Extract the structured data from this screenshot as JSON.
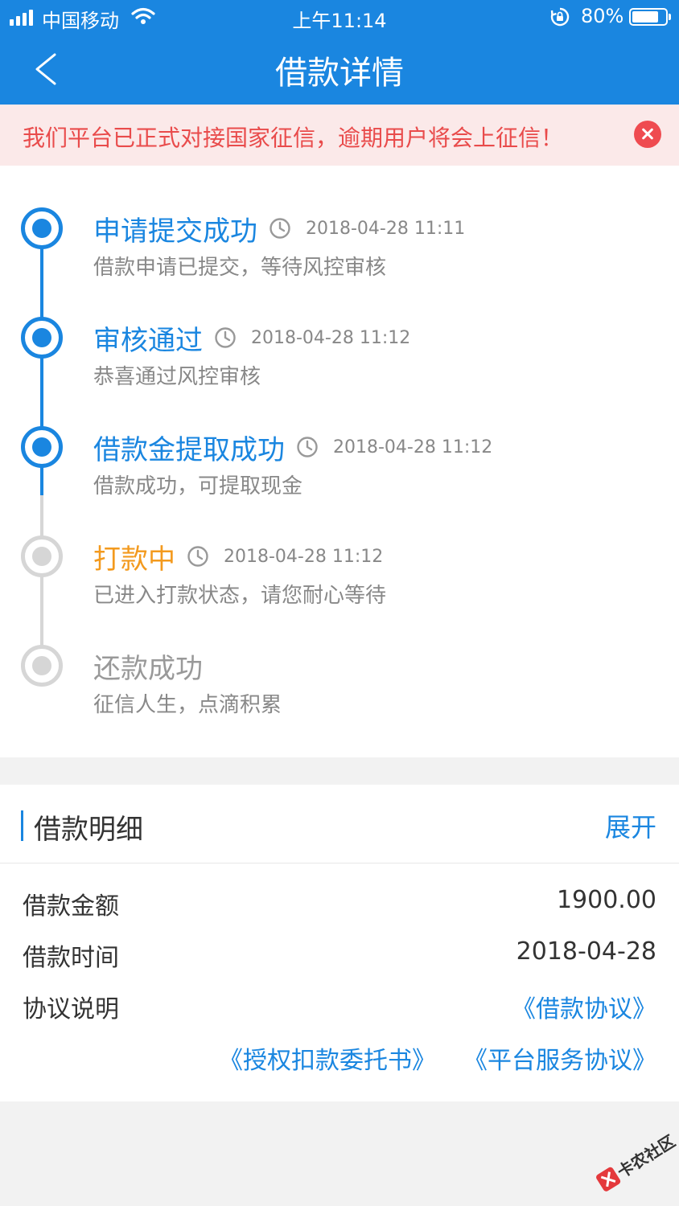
{
  "status_bar": {
    "carrier": "中国移动",
    "time": "上午11:14",
    "battery": "80%",
    "battery_level": 0.8
  },
  "nav": {
    "title": "借款详情"
  },
  "notice": {
    "text": "我们平台已正式对接国家征信，逾期用户将会上征信！"
  },
  "timeline": [
    {
      "title": "申请提交成功",
      "time": "2018-04-28 11:11",
      "desc": "借款申请已提交，等待风控审核",
      "state": "done"
    },
    {
      "title": "审核通过",
      "time": "2018-04-28 11:12",
      "desc": "恭喜通过风控审核",
      "state": "done"
    },
    {
      "title": "借款金提取成功",
      "time": "2018-04-28 11:12",
      "desc": "借款成功，可提取现金",
      "state": "done"
    },
    {
      "title": "打款中",
      "time": "2018-04-28 11:12",
      "desc": "已进入打款状态，请您耐心等待",
      "state": "current"
    },
    {
      "title": "还款成功",
      "time": "",
      "desc": "征信人生，点滴积累",
      "state": "pending"
    }
  ],
  "colors": {
    "primary": "#1a86e0",
    "current": "#f39a1e",
    "pending_text": "#999999",
    "line_done": "#1a86e0",
    "line_pending": "#d6d6d6"
  },
  "detail": {
    "title": "借款明细",
    "expand": "展开",
    "rows": [
      {
        "label": "借款金额",
        "value": "1900.00"
      },
      {
        "label": "借款时间",
        "value": "2018-04-28"
      },
      {
        "label": "协议说明",
        "value": ""
      }
    ],
    "links": {
      "loan": "《借款协议》",
      "auth": "《授权扣款委托书》",
      "service": "《平台服务协议》"
    }
  },
  "watermark": {
    "text": "卡农社区"
  }
}
